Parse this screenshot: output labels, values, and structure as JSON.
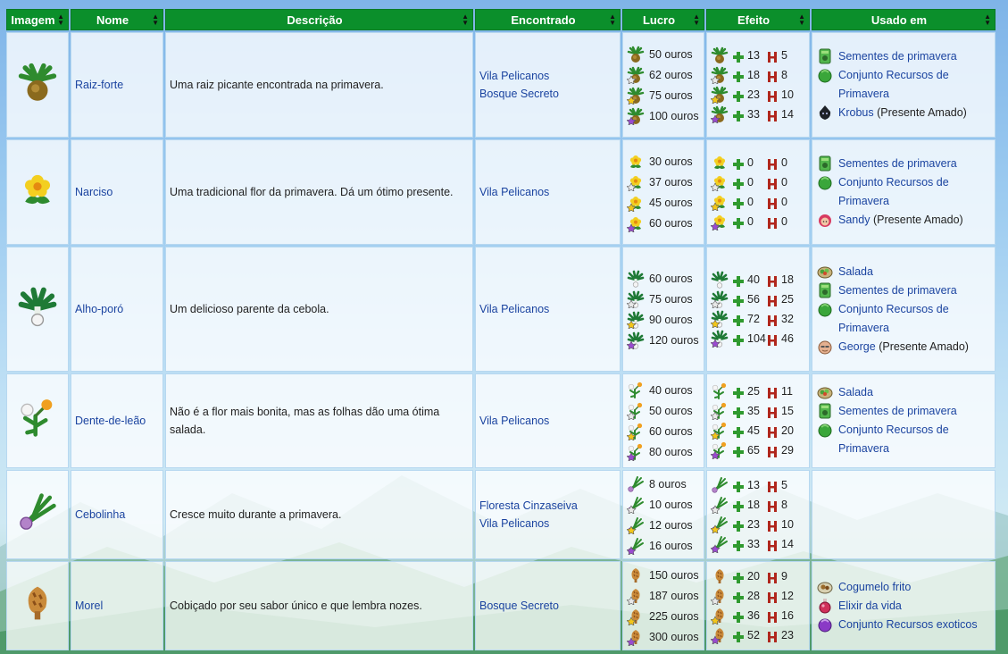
{
  "table": {
    "headers": [
      "Imagem",
      "Nome",
      "Descrição",
      "Encontrado",
      "Lucro",
      "Efeito",
      "Usado em"
    ],
    "rows": [
      {
        "name": "Raiz-forte",
        "icon": "horseradish-icon",
        "description": "Uma raiz picante encontrada na primavera.",
        "found": [
          "Vila Pelicanos",
          "Bosque Secreto"
        ],
        "profit": [
          "50 ouros",
          "62 ouros",
          "75 ouros",
          "100 ouros"
        ],
        "effect": [
          [
            "13",
            "5"
          ],
          [
            "18",
            "8"
          ],
          [
            "23",
            "10"
          ],
          [
            "33",
            "14"
          ]
        ],
        "used": [
          {
            "icon": "seed-pack-icon",
            "link": "Sementes de primavera",
            "extra": ""
          },
          {
            "icon": "bundle-icon",
            "link": "Conjunto Recursos de Primavera",
            "extra": ""
          },
          {
            "icon": "krobus-icon",
            "link": "Krobus",
            "extra": "(Presente Amado)"
          }
        ]
      },
      {
        "name": "Narciso",
        "icon": "daffodil-icon",
        "description": "Uma tradicional flor da primavera. Dá um ótimo presente.",
        "found": [
          "Vila Pelicanos"
        ],
        "profit": [
          "30 ouros",
          "37 ouros",
          "45 ouros",
          "60 ouros"
        ],
        "effect": [
          [
            "0",
            "0"
          ],
          [
            "0",
            "0"
          ],
          [
            "0",
            "0"
          ],
          [
            "0",
            "0"
          ]
        ],
        "used": [
          {
            "icon": "seed-pack-icon",
            "link": "Sementes de primavera",
            "extra": ""
          },
          {
            "icon": "bundle-icon",
            "link": "Conjunto Recursos de Primavera",
            "extra": ""
          },
          {
            "icon": "sandy-icon",
            "link": "Sandy",
            "extra": "(Presente Amado)"
          }
        ]
      },
      {
        "name": "Alho-poró",
        "icon": "leek-icon",
        "description": "Um delicioso parente da cebola.",
        "found": [
          "Vila Pelicanos"
        ],
        "profit": [
          "60 ouros",
          "75 ouros",
          "90 ouros",
          "120 ouros"
        ],
        "effect": [
          [
            "40",
            "18"
          ],
          [
            "56",
            "25"
          ],
          [
            "72",
            "32"
          ],
          [
            "104",
            "46"
          ]
        ],
        "used": [
          {
            "icon": "salad-icon",
            "link": "Salada",
            "extra": ""
          },
          {
            "icon": "seed-pack-icon",
            "link": "Sementes de primavera",
            "extra": ""
          },
          {
            "icon": "bundle-icon",
            "link": "Conjunto Recursos de Primavera",
            "extra": ""
          },
          {
            "icon": "george-icon",
            "link": "George",
            "extra": "(Presente Amado)"
          }
        ]
      },
      {
        "name": "Dente-de-leão",
        "icon": "dandelion-icon",
        "description": "Não é a flor mais bonita, mas as folhas dão uma ótima salada.",
        "found": [
          "Vila Pelicanos"
        ],
        "profit": [
          "40 ouros",
          "50 ouros",
          "60 ouros",
          "80 ouros"
        ],
        "effect": [
          [
            "25",
            "11"
          ],
          [
            "35",
            "15"
          ],
          [
            "45",
            "20"
          ],
          [
            "65",
            "29"
          ]
        ],
        "used": [
          {
            "icon": "salad-icon",
            "link": "Salada",
            "extra": ""
          },
          {
            "icon": "seed-pack-icon",
            "link": "Sementes de primavera",
            "extra": ""
          },
          {
            "icon": "bundle-icon",
            "link": "Conjunto Recursos de Primavera",
            "extra": ""
          }
        ]
      },
      {
        "name": "Cebolinha",
        "icon": "spring-onion-icon",
        "description": "Cresce muito durante a primavera.",
        "found": [
          "Floresta Cinzaseiva",
          "Vila Pelicanos"
        ],
        "profit": [
          "8 ouros",
          "10 ouros",
          "12 ouros",
          "16 ouros"
        ],
        "effect": [
          [
            "13",
            "5"
          ],
          [
            "18",
            "8"
          ],
          [
            "23",
            "10"
          ],
          [
            "33",
            "14"
          ]
        ],
        "used": []
      },
      {
        "name": "Morel",
        "icon": "morel-icon",
        "description": "Cobiçado por seu sabor único e que lembra nozes.",
        "found": [
          "Bosque Secreto"
        ],
        "profit": [
          "150 ouros",
          "187 ouros",
          "225 ouros",
          "300 ouros"
        ],
        "effect": [
          [
            "20",
            "9"
          ],
          [
            "28",
            "12"
          ],
          [
            "36",
            "16"
          ],
          [
            "52",
            "23"
          ]
        ],
        "used": [
          {
            "icon": "fried-mushroom-icon",
            "link": "Cogumelo frito",
            "extra": ""
          },
          {
            "icon": "life-elixir-icon",
            "link": "Elixir da vida",
            "extra": ""
          },
          {
            "icon": "exotic-bundle-icon",
            "link": "Conjunto Recursos exoticos",
            "extra": ""
          }
        ]
      }
    ],
    "quality_tiers": [
      "normal",
      "silver-star",
      "gold-star",
      "iridium-star"
    ]
  },
  "colors": {
    "header_green": "#0b8f2b",
    "link_blue": "#1b44a0",
    "energy_green": "#2f9a2f",
    "health_red": "#b0261c"
  }
}
